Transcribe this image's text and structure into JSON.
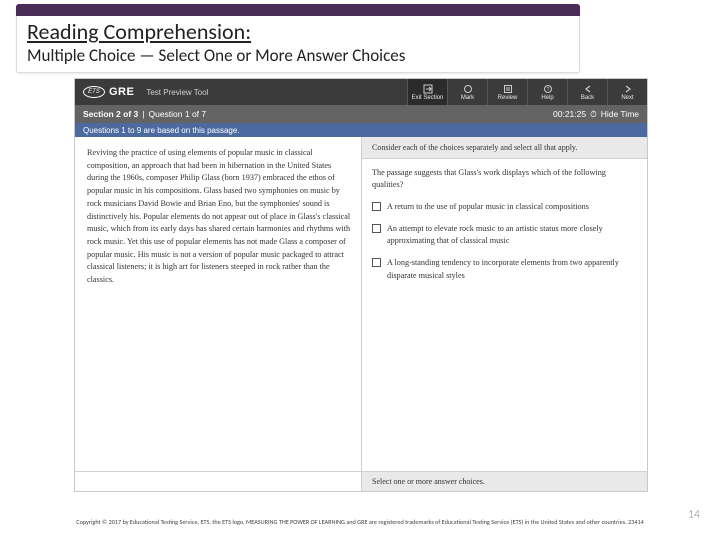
{
  "slide": {
    "title": "Reading Comprehension:",
    "subtitle": "Multiple Choice — Select One or More Answer Choices",
    "page_number": "14",
    "copyright": "Copyright © 2017 by Educational Testing Service. ETS, the ETS logo, MEASURING THE POWER OF LEARNING and GRE are registered trademarks of Educational Testing Service (ETS) in the United States and other countries. 23414"
  },
  "app": {
    "brand_ets": "ETS",
    "brand_gre": "GRE",
    "tool_label": "Test Preview Tool",
    "nav": {
      "exit": "Exit Section",
      "mark": "Mark",
      "review": "Review",
      "help": "Help",
      "back": "Back",
      "next": "Next"
    },
    "section_label": "Section 2 of 3",
    "question_label": "Question 1 of 7",
    "timer": "00:21:25",
    "hide_time": "Hide Time",
    "band": "Questions 1 to 9 are based on this passage.",
    "passage": "Reviving the practice of using elements of popular music in classical composition, an approach that had been in hibernation in the United States during the 1960s, composer Philip Glass (born 1937) embraced the ethos of popular music in his compositions. Glass based two symphonies on music by rock musicians David Bowie and Brian Eno, but the symphonies' sound is distinctively his. Popular elements do not appear out of place in Glass's classical music, which from its early days has shared certain harmonies and rhythms with rock music. Yet this use of popular elements has not made Glass a composer of popular music. His music is not a version of popular music packaged to attract classical listeners; it is high art for listeners steeped in rock rather than the classics.",
    "instruction": "Consider each of the choices separately and select all that apply.",
    "question": "The passage suggests that Glass's work displays which of the following qualities?",
    "options": [
      "A return to the use of popular music in classical compositions",
      "An attempt to elevate rock music to an artistic status more closely approximating that of classical music",
      "A long-standing tendency to incorporate elements from two apparently disparate musical styles"
    ],
    "footer_hint": "Select one or more answer choices."
  }
}
